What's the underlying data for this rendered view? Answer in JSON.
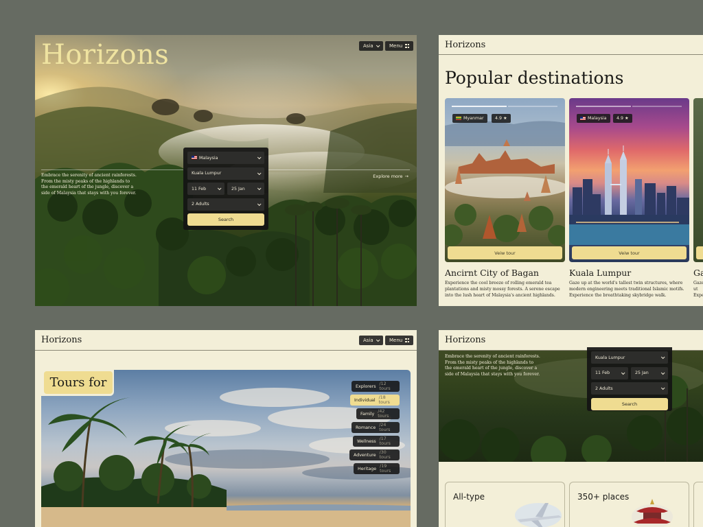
{
  "brand": "Horizons",
  "nav": {
    "region": "Asia",
    "menu": "Menu"
  },
  "hero": {
    "title": "Horizons",
    "description": "Embrace the serenity of ancient rainforests. From the misty peaks of the highlands to the emerald heart of the jungle, discover a side of Malaysia that stays with you forever.",
    "explore": "Explore more"
  },
  "search": {
    "country": "Malaysia",
    "city": "Kuala Lumpur",
    "date_from": "11 Feb",
    "date_to": "25 Jan",
    "guests": "2 Adults",
    "button": "Search"
  },
  "popular": {
    "title": "Popular destinations",
    "cards": [
      {
        "country": "Myanmar",
        "rating": "4.9 ★",
        "button": "Veiw tour",
        "name": "Ancirnt City of Bagan",
        "desc": "Experience the cool breeze of rolling emerald tea plantations and misty mossy forests. A serene escape into the lush heart of Malaysia's ancient highlands."
      },
      {
        "country": "Malaysia",
        "rating": "4.9 ★",
        "button": "Veiw tour",
        "name": "Kuala Lumpur",
        "desc": "Gaze up at the world's tallest twin structures, where modern engineering meets traditional Islamic motifs. Experience the breathtaking skybridge walk."
      },
      {
        "name": "Ga",
        "desc": "Gaze ut Expe"
      }
    ]
  },
  "tours": {
    "title": "Tours for",
    "categories": [
      {
        "label": "Explorers",
        "count": "/12 tours"
      },
      {
        "label": "Individual",
        "count": "/18 tours"
      },
      {
        "label": "Family",
        "count": "/42 tours"
      },
      {
        "label": "Romance",
        "count": "/24 tours"
      },
      {
        "label": "Wellness",
        "count": "/17 tours"
      },
      {
        "label": "Adventure",
        "count": "/30 tours"
      },
      {
        "label": "Heritage",
        "count": "/19 tours"
      }
    ]
  },
  "features": [
    {
      "label": "All-type"
    },
    {
      "label": "350+ places"
    }
  ],
  "colors": {
    "accent": "#efdc91",
    "panel_bg": "#f3efd8",
    "page_bg": "#666b62",
    "dark_chip": "#1c1c1c"
  }
}
